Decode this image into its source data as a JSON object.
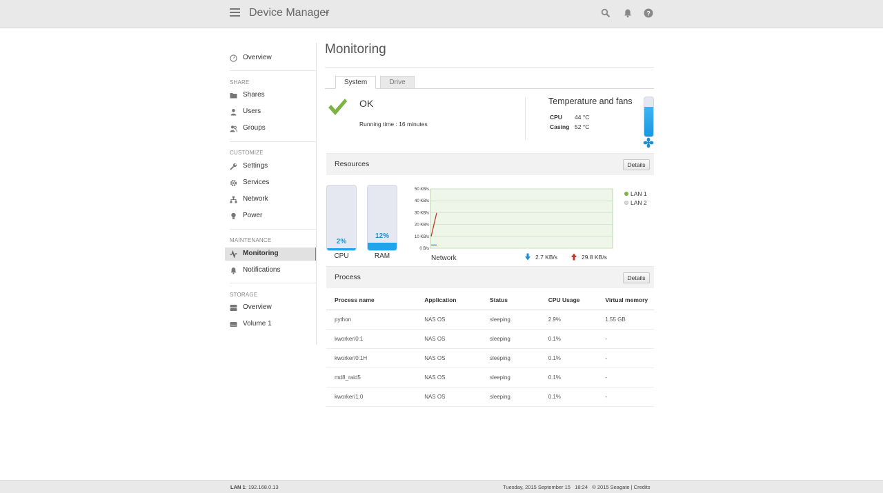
{
  "header": {
    "title": "Device Manager",
    "icons": [
      "menu-icon",
      "search-icon",
      "bell-icon",
      "help-icon"
    ]
  },
  "sidebar": {
    "overview": "Overview",
    "sections": {
      "share": "SHARE",
      "customize": "CUSTOMIZE",
      "maintenance": "MAINTENANCE",
      "storage": "STORAGE"
    },
    "items": {
      "shares": "Shares",
      "users": "Users",
      "groups": "Groups",
      "settings": "Settings",
      "services": "Services",
      "network": "Network",
      "power": "Power",
      "monitoring": "Monitoring",
      "notifications": "Notifications",
      "storage_overview": "Overview",
      "volume1": "Volume 1"
    },
    "active": "Monitoring"
  },
  "main": {
    "title": "Monitoring",
    "tabs": [
      "System",
      "Drive"
    ],
    "status": {
      "text": "OK",
      "running_time": "Running time : 16 minutes"
    },
    "temperature": {
      "title": "Temperature and fans",
      "cpu_label": "CPU",
      "cpu_value": "44 °C",
      "casing_label": "Casing",
      "casing_value": "52 °C",
      "level": 0.75
    },
    "resources": {
      "title": "Resources",
      "details": "Details",
      "cpu_label": "CPU",
      "cpu_value": "2%",
      "cpu_fraction": 0.02,
      "ram_label": "RAM",
      "ram_value": "12%",
      "ram_fraction": 0.12,
      "network_label": "Network",
      "down_rate": "2.7 KB/s",
      "up_rate": "29.8 KB/s",
      "legend": [
        "LAN 1",
        "LAN 2"
      ]
    },
    "process": {
      "title": "Process",
      "details": "Details",
      "columns": [
        "Process name",
        "Application",
        "Status",
        "CPU Usage",
        "Virtual memory"
      ],
      "rows": [
        [
          "python",
          "NAS OS",
          "sleeping",
          "2.9%",
          "1.55 GB"
        ],
        [
          "kworker/0:1",
          "NAS OS",
          "sleeping",
          "0.1%",
          "-"
        ],
        [
          "kworker/0:1H",
          "NAS OS",
          "sleeping",
          "0.1%",
          "-"
        ],
        [
          "md8_raid5",
          "NAS OS",
          "sleeping",
          "0.1%",
          "-"
        ],
        [
          "kworker/1:0",
          "NAS OS",
          "sleeping",
          "0.1%",
          "-"
        ]
      ]
    }
  },
  "chart_data": {
    "type": "line",
    "title": "Network",
    "ylim": [
      0,
      50
    ],
    "yticks": [
      "0 B/s",
      "10 KB/s",
      "20 KB/s",
      "30 KB/s",
      "40 KB/s",
      "50 KB/s"
    ],
    "series": [
      {
        "name": "LAN 1",
        "color": "#7cb342",
        "values": []
      },
      {
        "name": "LAN 2",
        "color": "#cccccc",
        "values": []
      },
      {
        "color": "#c0392b",
        "values": [
          10,
          29.8
        ]
      },
      {
        "color": "#1a8fd3",
        "values": [
          2.7,
          2.7
        ]
      }
    ]
  },
  "footer": {
    "lan_label": "LAN 1",
    "lan_ip": ": 192.168.0.13",
    "right": "Tuesday, 2015 September 15   18:24   © 2015 Seagate | Credits"
  },
  "colors": {
    "accent": "#1a8fd3",
    "ok": "#7cb342",
    "upload": "#c0392b"
  }
}
